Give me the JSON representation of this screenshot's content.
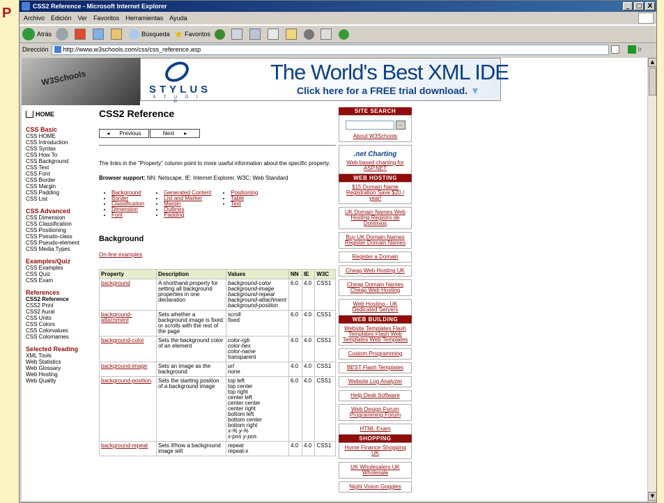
{
  "window": {
    "title": "CSS2 Reference - Microsoft Internet Explorer",
    "corner_mark": "P",
    "controls": [
      "_",
      "Έ",
      "X"
    ]
  },
  "menu": [
    "Archivo",
    "Edición",
    "Ver",
    "Favoritos",
    "Herramientas",
    "Ayuda"
  ],
  "toolbar": {
    "back_label": "Atrás",
    "search_label": "Búsqueda",
    "favorites_label": "Favoritos"
  },
  "address": {
    "label": "Dirección",
    "url": "http://www.w3schools.com/css/css_reference.asp",
    "go_label": "Ir"
  },
  "banner": {
    "keyboard_text": "W3Schools",
    "ad_brand": "STYLUS",
    "ad_sub": "S T U D I O",
    "ad_headline": "The World's Best XML IDE",
    "ad_cta": "Click here for a FREE trial download."
  },
  "leftnav": {
    "home": "HOME",
    "sections": [
      {
        "title": "CSS Basic",
        "items": [
          "CSS HOME",
          "CSS Introduction",
          "CSS Syntax",
          "CSS How To",
          "CSS Background",
          "CSS Text",
          "CSS Font",
          "CSS Border",
          "CSS Margin",
          "CSS Padding",
          "CSS List"
        ]
      },
      {
        "title": "CSS Advanced",
        "items": [
          "CSS Dimension",
          "CSS Classification",
          "CSS Positioning",
          "CSS Pseudo-class",
          "CSS Pseudo-element",
          "CSS Media Types"
        ]
      },
      {
        "title": "Examples/Quiz",
        "items": [
          "CSS Examples",
          "CSS Quiz",
          "CSS Exam"
        ]
      },
      {
        "title": "References",
        "items": [
          "CSS2 Reference",
          "CSS2 Print",
          "CSS2 Aural",
          "CSS Units",
          "CSS Colors",
          "CSS Colorvalues",
          "CSS Colornames"
        ]
      },
      {
        "title": "Selected Reading",
        "items": [
          "XML Tools",
          "Web Statistics",
          "Web Glossary",
          "Web Hosting",
          "Web Quality"
        ]
      }
    ]
  },
  "main": {
    "title": "CSS2 Reference",
    "prev_label": "Previous",
    "next_label": "Next",
    "intro": "The links in the \"Property\" column point to more useful information about the specific property.",
    "browser_support_label": "Browser support:",
    "browser_support_text": "NN: Netscape, IE: Internet Explorer, W3C: Web Standard",
    "links_col1": [
      "Background",
      "Border",
      "Classification",
      "Dimension",
      "Font"
    ],
    "links_col2": [
      "Generated Content",
      "List and Marker",
      "Margin",
      "Outlines",
      "Padding"
    ],
    "links_col3": [
      "Positioning",
      "Table",
      "Text"
    ],
    "section_title": "Background",
    "online_examples": "On-line examples",
    "table_headers": [
      "Property",
      "Description",
      "Values",
      "NN",
      "IE",
      "W3C"
    ],
    "table_rows": [
      {
        "property": "background",
        "description": "A shorthand property for setting all background properties in one declaration",
        "values": [
          "background-color",
          "background-image",
          "background-repeat",
          "background-attachment",
          "background-position"
        ],
        "nn": "6.0",
        "ie": "4.0",
        "w3c": "CSS1"
      },
      {
        "property": "background-attachment",
        "description": "Sets whether a background image is fixed or scrolls with the rest of the page",
        "values": [
          "scroll",
          "fixed"
        ],
        "nn": "6.0",
        "ie": "4.0",
        "w3c": "CSS1"
      },
      {
        "property": "background-color",
        "description": "Sets the background color of an element",
        "values": [
          "color-rgb",
          "color-hex",
          "color-name",
          "transparent"
        ],
        "nn": "4.0",
        "ie": "4.0",
        "w3c": "CSS1"
      },
      {
        "property": "background-image",
        "description": "Sets an image as the background",
        "values": [
          "url",
          "none"
        ],
        "nn": "4.0",
        "ie": "4.0",
        "w3c": "CSS1"
      },
      {
        "property": "background-position",
        "description": "Sets the starting position of a background image",
        "values": [
          "top left",
          "top center",
          "top right",
          "center left",
          "center center",
          "center right",
          "bottom left",
          "bottom center",
          "bottom right",
          "x-% y-%",
          "x-pos y-pos"
        ],
        "nn": "6.0",
        "ie": "4.0",
        "w3c": "CSS1"
      },
      {
        "property": "background-repeat",
        "description": "Sets if/how a background image will",
        "values": [
          "repeat",
          "repeat-x"
        ],
        "nn": "4.0",
        "ie": "4.0",
        "w3c": "CSS1"
      }
    ]
  },
  "right": {
    "site_search": "SITE SEARCH",
    "search_button": "...",
    "about": "About W3Schools",
    "netcharting_logo": ".net Charting",
    "netcharting_link": "Web based charting for ASP.NET",
    "web_hosting_header": "WEB HOSTING",
    "domain_offer": "$15 Domain Name Registration Save $20 / year!",
    "boxes1": [
      "UK Domain Names Web Hosting Registro de Dominios",
      "Buy UK Domain Names Register Domain Names",
      "Register a Domain",
      "Cheap Web Hosting UK",
      "Cheap Domain Names Cheap Web Hosting",
      "Web Hosting - UK Dedicated Servers"
    ],
    "web_building_header": "WEB BUILDING",
    "web_building_link": "Website Templates Flash Templates Flash Web Templates Web Templates",
    "boxes2": [
      "Custom Programming",
      "BEST Flash Templates",
      "Website Log Analyzer",
      "Help Desk Software",
      "Web Design Forum Programming Forum",
      "HTML Exam"
    ],
    "shopping_header": "SHOPPING",
    "shopping_link": "Home Finance Shopping UK",
    "boxes3": [
      "UK Wholesalers UK Wholesale",
      "Night Vision Goggles"
    ]
  }
}
